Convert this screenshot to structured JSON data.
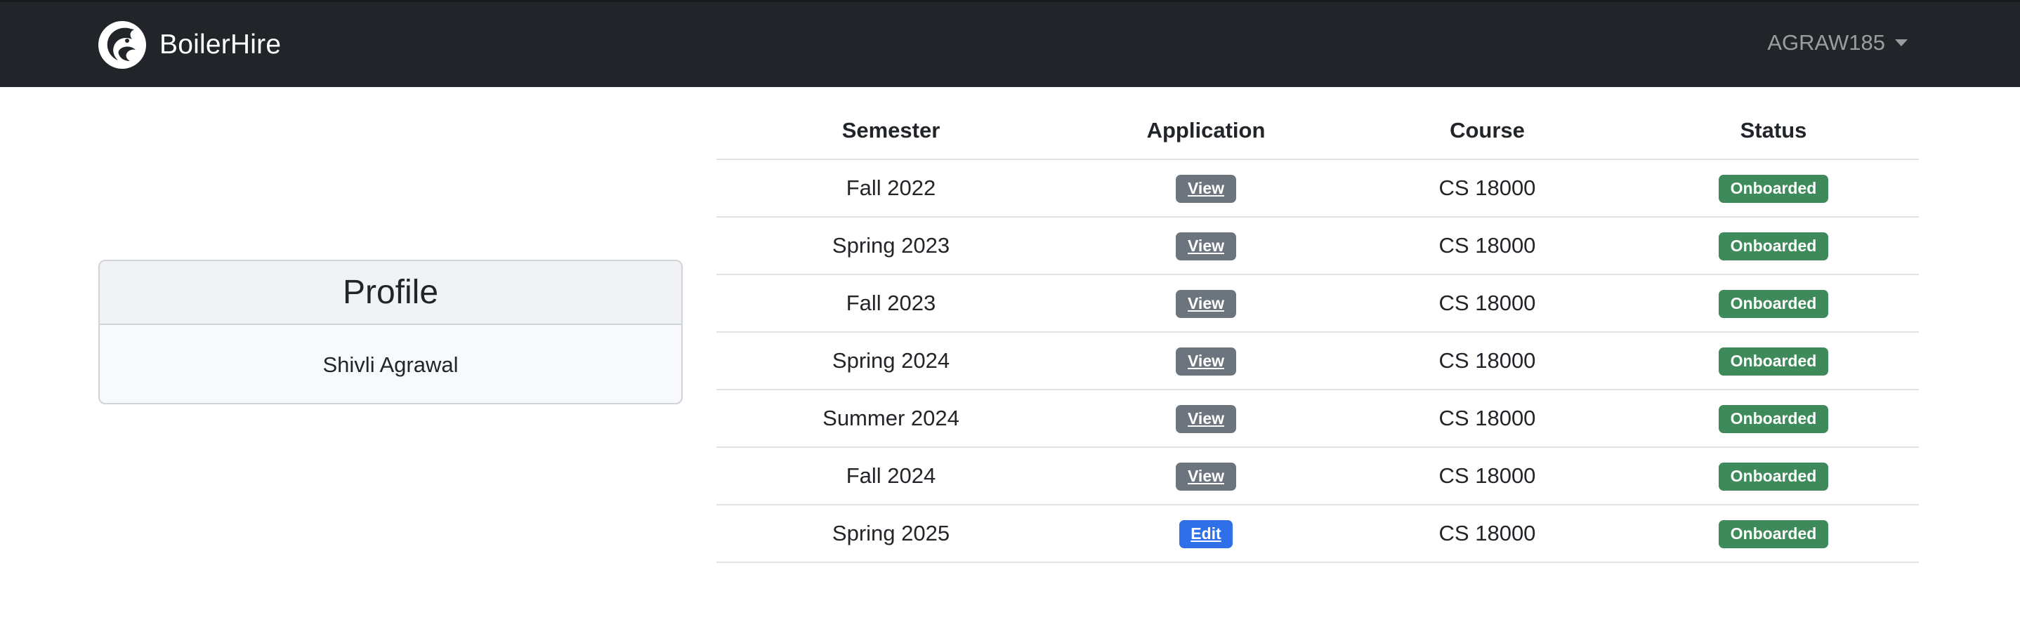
{
  "navbar": {
    "brand_name": "BoilerHire",
    "brand_icon": "boiler-hire-logo",
    "user_label": "AGRAW185",
    "colors": {
      "background": "#212529"
    }
  },
  "profile": {
    "title": "Profile",
    "name": "Shivli Agrawal"
  },
  "table": {
    "headers": [
      "Semester",
      "Application",
      "Course",
      "Status"
    ],
    "rows": [
      {
        "semester": "Fall 2022",
        "action": "View",
        "course": "CS 18000",
        "status": "Onboarded"
      },
      {
        "semester": "Spring 2023",
        "action": "View",
        "course": "CS 18000",
        "status": "Onboarded"
      },
      {
        "semester": "Fall 2023",
        "action": "View",
        "course": "CS 18000",
        "status": "Onboarded"
      },
      {
        "semester": "Spring 2024",
        "action": "View",
        "course": "CS 18000",
        "status": "Onboarded"
      },
      {
        "semester": "Summer 2024",
        "action": "View",
        "course": "CS 18000",
        "status": "Onboarded"
      },
      {
        "semester": "Fall 2024",
        "action": "View",
        "course": "CS 18000",
        "status": "Onboarded"
      },
      {
        "semester": "Spring 2025",
        "action": "Edit",
        "course": "CS 18000",
        "status": "Onboarded"
      }
    ],
    "colors": {
      "view_button": "#6c757d",
      "edit_button": "#2f6fe8",
      "status_badge": "#3f8a5a"
    }
  }
}
